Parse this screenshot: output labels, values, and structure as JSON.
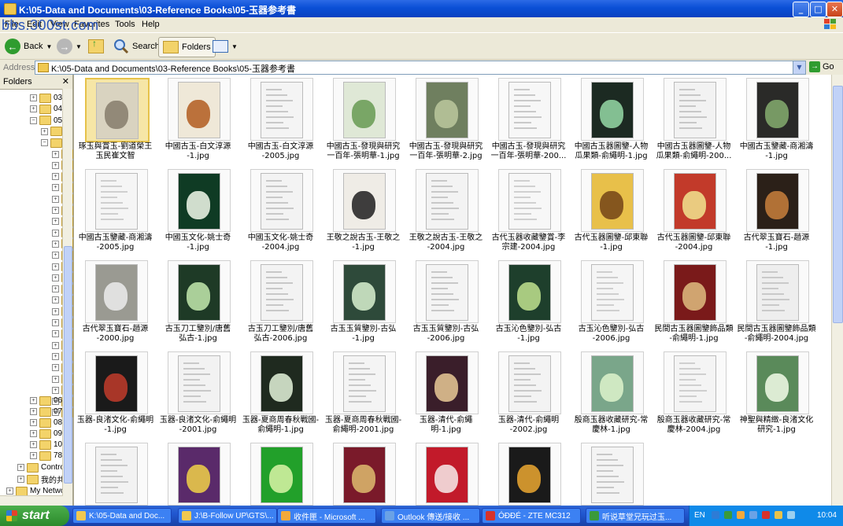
{
  "window": {
    "title": "K:\\05-Data and Documents\\03-Reference Books\\05-玉器参考書"
  },
  "watermark": "bbs.300st.com",
  "menu": [
    "File",
    "Edit",
    "View",
    "Favorites",
    "Tools",
    "Help"
  ],
  "toolbar": {
    "back": "Back",
    "search": "Search",
    "folders": "Folders"
  },
  "address": {
    "label": "Address",
    "path": "K:\\05-Data and Documents\\03-Reference Books\\05-玉器参考書",
    "go": "Go"
  },
  "folders_pane": {
    "title": "Folders",
    "items": [
      "03",
      "04",
      "05",
      "",
      "",
      "",
      "",
      "",
      "",
      "",
      "",
      "",
      "",
      "",
      "",
      "",
      "",
      "",
      "",
      "",
      "",
      "",
      "",
      "",
      "",
      "",
      "",
      "",
      "",
      "06",
      "07",
      "08",
      "09",
      "10",
      "78",
      "Contro",
      "我的共",
      "My Netwo"
    ]
  },
  "thumbnails": [
    {
      "l1": "琢玉與賞玉-劉道榮王",
      "l2": "玉民崔文智"
    },
    {
      "l1": "中國古玉-白文淳源",
      "l2": "-1.jpg"
    },
    {
      "l1": "中國古玉-白文淳源",
      "l2": "-2005.jpg"
    },
    {
      "l1": "中國古玉-發現與研究",
      "l2": "一百年-張明華-1.jpg"
    },
    {
      "l1": "中國古玉-發現與研究",
      "l2": "一百年-張明華-2.jpg"
    },
    {
      "l1": "中國古玉-發現與研究",
      "l2": "一百年-張明華-200..."
    },
    {
      "l1": "中國古玉器圖鑒-人物",
      "l2": "瓜果類-俞繩明-1.jpg"
    },
    {
      "l1": "中國古玉器圖鑒-人物",
      "l2": "瓜果類-俞繩明-200..."
    },
    {
      "l1": "中國古玉鑒藏-商湘濤",
      "l2": "-1.jpg"
    },
    {
      "l1": "中國古玉鑒藏-商湘濤",
      "l2": "-2005.jpg"
    },
    {
      "l1": "中國玉文化-姚士奇",
      "l2": "-1.jpg"
    },
    {
      "l1": "中國玉文化-姚士奇",
      "l2": "-2004.jpg"
    },
    {
      "l1": "王敬之說古玉-王敬之",
      "l2": "-1.jpg"
    },
    {
      "l1": "王敬之說古玉-王敬之",
      "l2": "-2004.jpg"
    },
    {
      "l1": "古代玉器收藏鑒賞-李",
      "l2": "宗建-2004.jpg"
    },
    {
      "l1": "古代玉器圖鑒-邱東聯",
      "l2": "-1.jpg"
    },
    {
      "l1": "古代玉器圖鑒-邱東聯",
      "l2": "-2004.jpg"
    },
    {
      "l1": "古代翠玉寶石-趙源",
      "l2": "-1.jpg"
    },
    {
      "l1": "古代翠玉寶石-趙源",
      "l2": "-2000.jpg"
    },
    {
      "l1": "古玉刀工鑒別/唐舊",
      "l2": "弘古-1.jpg"
    },
    {
      "l1": "古玉刀工鑒別/唐舊",
      "l2": "弘古-2006.jpg"
    },
    {
      "l1": "古玉玉質鑒別-古弘",
      "l2": "-1.jpg"
    },
    {
      "l1": "古玉玉質鑒別-古弘",
      "l2": "-2006.jpg"
    },
    {
      "l1": "古玉沁色鑒別-弘古",
      "l2": "-1.jpg"
    },
    {
      "l1": "古玉沁色鑒別-弘古",
      "l2": "-2006.jpg"
    },
    {
      "l1": "民間古玉器圖鑒飾品類",
      "l2": "-俞繩明-1.jpg"
    },
    {
      "l1": "民間古玉器圖鑒飾品類",
      "l2": "-俞繩明-2004.jpg"
    },
    {
      "l1": "玉器-良渚文化-俞繩明",
      "l2": "-1.jpg"
    },
    {
      "l1": "玉器-良渚文化-俞繩明",
      "l2": "-2001.jpg"
    },
    {
      "l1": "玉器-夏商周春秋戰國-",
      "l2": "俞繩明-1.jpg"
    },
    {
      "l1": "玉器-夏商周春秋戰國-",
      "l2": "俞繩明-2001.jpg"
    },
    {
      "l1": "玉器-清代-俞繩明-1.jpg",
      "l2": ""
    },
    {
      "l1": "玉器-清代-俞繩明",
      "l2": "-2002.jpg"
    },
    {
      "l1": "殷商玉器收藏研究-常",
      "l2": "慶林-1.jpg"
    },
    {
      "l1": "殷商玉器收藏研究-常",
      "l2": "慶林-2004.jpg"
    },
    {
      "l1": "神聖與精緻-良渚文化",
      "l2": "研究-1.jpg"
    },
    {
      "l1": "",
      "l2": ""
    },
    {
      "l1": "",
      "l2": ""
    },
    {
      "l1": "",
      "l2": ""
    },
    {
      "l1": "",
      "l2": ""
    },
    {
      "l1": "",
      "l2": ""
    },
    {
      "l1": "",
      "l2": ""
    },
    {
      "l1": "",
      "l2": ""
    }
  ],
  "cover_text": [
    "中國古玉",
    "中國玉文化",
    "古代玉器",
    "古代翠玉寶石",
    "古玉刀工鑒別",
    "古玉玉質鑒別",
    "古玉沁色鑒別",
    "民間古玉器圖鑒",
    "清代玉器",
    "殷商玉器收藏研究",
    "神聖與精緻"
  ],
  "taskbar": {
    "start": "start",
    "tasks": [
      {
        "label": "K:\\05-Data and Doc...",
        "color": "#f0c850"
      },
      {
        "label": "J:\\B-Follow UP\\GTS\\...",
        "color": "#f0c850"
      },
      {
        "label": "收件匣 - Microsoft ...",
        "color": "#f2a93b"
      },
      {
        "label": "Outlook 傳送/接收 ...",
        "color": "#6aa2e6"
      },
      {
        "label": "ÓÐÐÉ - ZTE MC312",
        "color": "#d8322a"
      },
      {
        "label": "听说草堂兄玩过玉...",
        "color": "#3a9a3a"
      }
    ],
    "lang": "EN",
    "clock": "10:04"
  }
}
